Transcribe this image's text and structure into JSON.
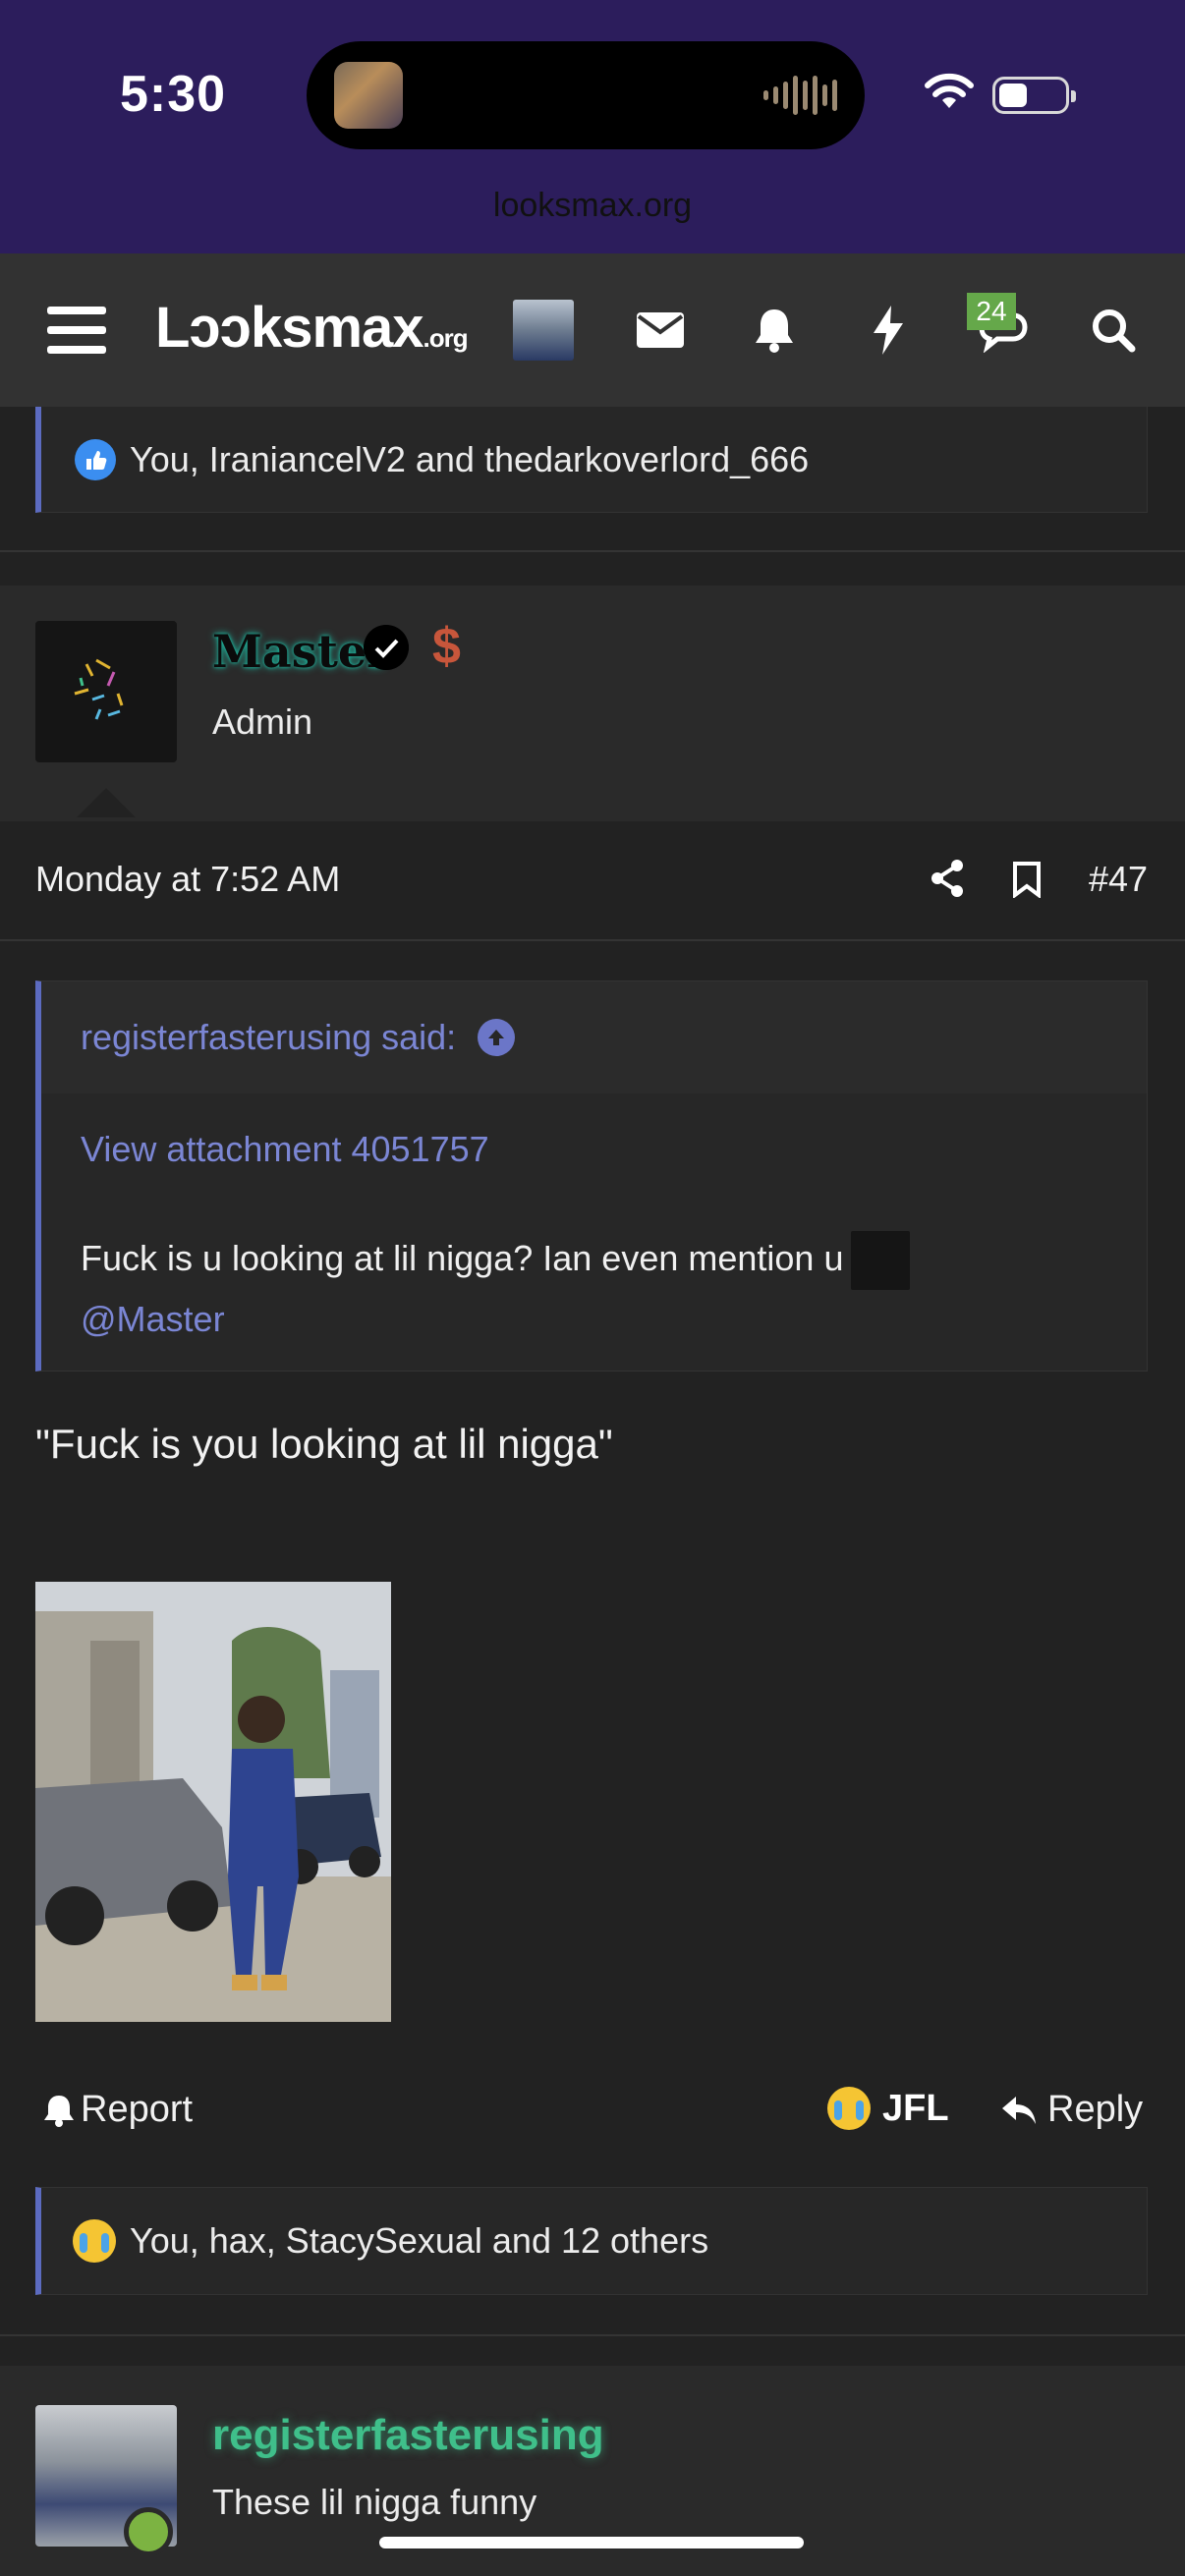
{
  "status_bar": {
    "time": "5:30",
    "url": "looksmax.org"
  },
  "nav": {
    "logo_main": "Lɔɔksmax",
    "logo_suffix": ".org",
    "chat_badge": "24",
    "icons": [
      "menu-icon",
      "avatar",
      "mail-icon",
      "bell-icon",
      "bolt-icon",
      "chat-icon",
      "search-icon"
    ]
  },
  "previous_reactions": "You, IraniancelV2 and thedarkoverlord_666",
  "post": {
    "author": "Master",
    "role": "Admin",
    "badge_symbol": "$",
    "date": "Monday at 7:52 AM",
    "number": "#47",
    "quote": {
      "header": "registerfasterusing said:",
      "attachment": "View attachment 4051757",
      "text": "Fuck is u looking at lil nigga? Ian even mention u",
      "mention": "@Master"
    },
    "body": "\"Fuck is you looking at lil nigga\"",
    "actions": {
      "report": "Report",
      "reaction": "JFL",
      "reply": "Reply"
    },
    "reactions": "You, hax, StacySexual and 12 others"
  },
  "next_post": {
    "author": "registerfasterusing",
    "title": "These lil nigga funny"
  },
  "colors": {
    "accent": "#5c6bc0",
    "link": "#7b86d4",
    "status_bg": "#2c1d5c",
    "online": "#7cb342"
  }
}
